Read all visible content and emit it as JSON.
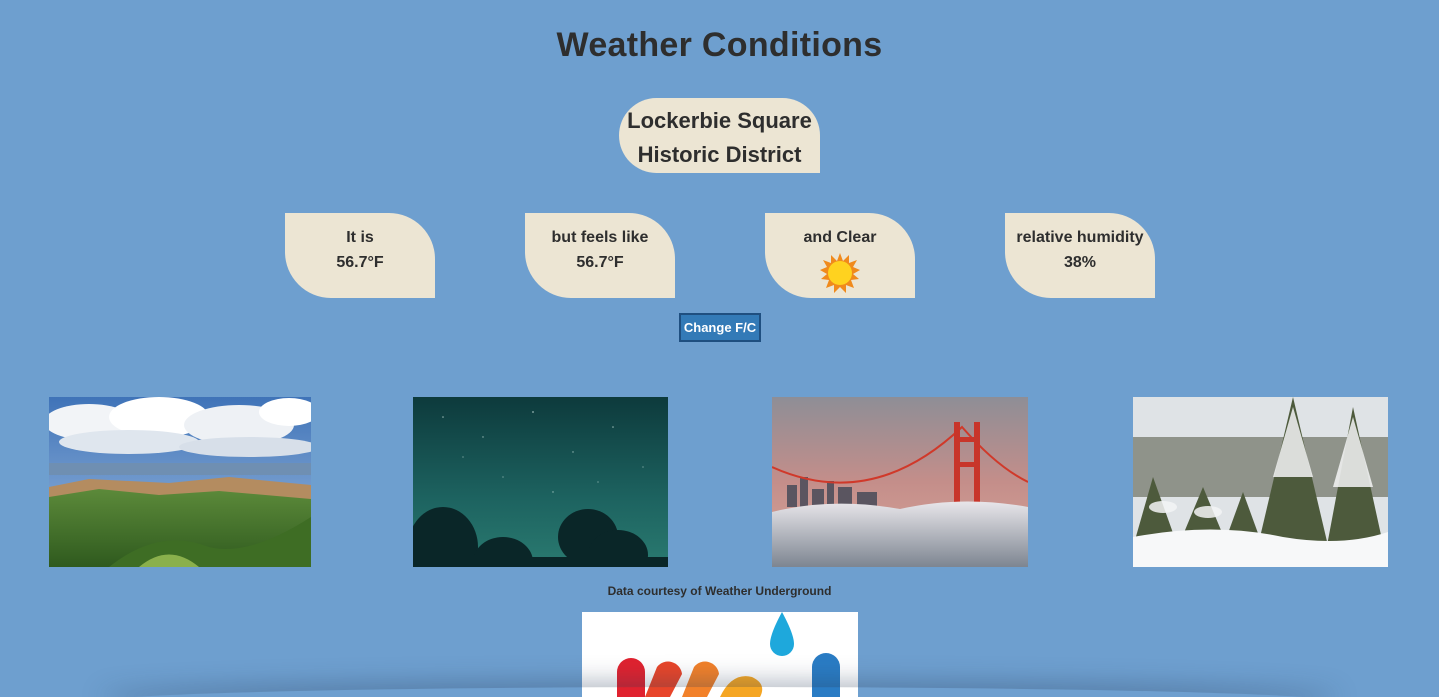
{
  "page": {
    "title": "Weather Conditions",
    "location_line1": "Lockerbie Square",
    "location_line2": "Historic District"
  },
  "conditions": {
    "temp_label": "It is",
    "temp_value": "56.7°F",
    "feels_label": "but feels like",
    "feels_value": "56.7°F",
    "sky_label": "and Clear",
    "sky_icon": "sun-icon",
    "humidity_label": "relative humidity",
    "humidity_value": "38%"
  },
  "controls": {
    "toggle_units_label": "Change F/C"
  },
  "photos": [
    {
      "name": "canyon-landscape-photo"
    },
    {
      "name": "night-sky-photo"
    },
    {
      "name": "golden-gate-fog-photo"
    },
    {
      "name": "snowy-forest-photo"
    }
  ],
  "footer": {
    "credit": "Data courtesy of Weather Underground",
    "logo_icon": "weather-underground-logo"
  },
  "colors": {
    "background": "#6e9fcf",
    "card": "#ece5d3",
    "button": "#337ab7"
  }
}
